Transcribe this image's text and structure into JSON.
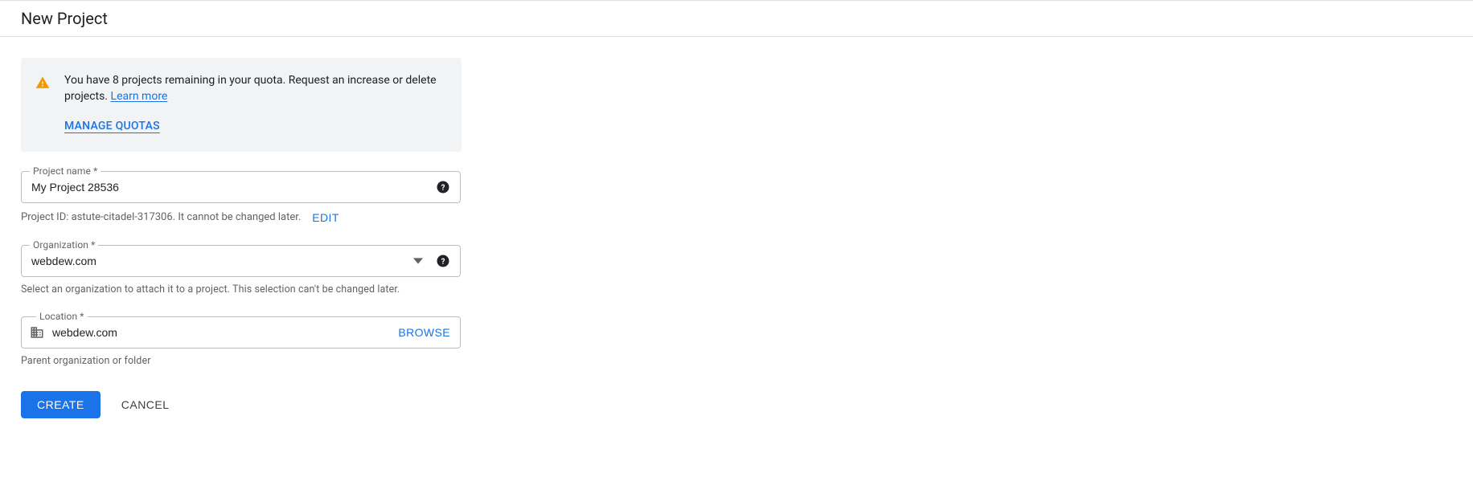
{
  "header": {
    "title": "New Project"
  },
  "notice": {
    "text_before_link": "You have 8 projects remaining in your quota. Request an increase or delete projects. ",
    "learn_more_label": "Learn more",
    "manage_quotas_label": "MANAGE QUOTAS"
  },
  "project_name": {
    "label": "Project name *",
    "value": "My Project 28536"
  },
  "project_id": {
    "prefix": "Project ID: ",
    "id_value": "astute-citadel-317306",
    "suffix": ". It cannot be changed later.",
    "edit_label": "EDIT"
  },
  "organization": {
    "label": "Organization *",
    "value": "webdew.com",
    "hint": "Select an organization to attach it to a project. This selection can't be changed later."
  },
  "location": {
    "label": "Location *",
    "value": "webdew.com",
    "browse_label": "BROWSE",
    "hint": "Parent organization or folder"
  },
  "actions": {
    "create_label": "CREATE",
    "cancel_label": "CANCEL"
  }
}
